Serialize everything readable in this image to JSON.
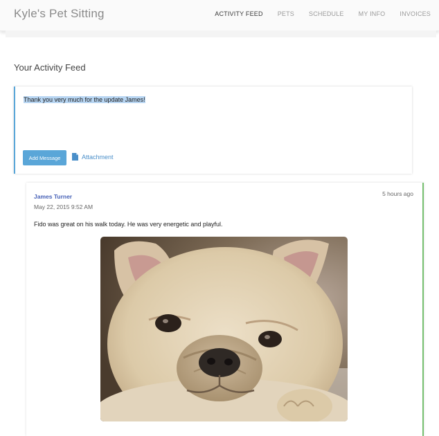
{
  "app": {
    "title": "Kyle's Pet Sitting"
  },
  "nav": {
    "items": [
      {
        "label": "ACTIVITY FEED"
      },
      {
        "label": "PETS"
      },
      {
        "label": "SCHEDULE"
      },
      {
        "label": "MY INFO"
      },
      {
        "label": "INVOICES"
      }
    ],
    "active": "ACTIVITY FEED"
  },
  "page": {
    "title": "Your Activity Feed"
  },
  "composer": {
    "message_value": "Thank you very much for the update James!",
    "add_button_label": "Add Message",
    "attachment_label": "Attachment",
    "accent_color": "#5aa6d8"
  },
  "feed": {
    "posts": [
      {
        "author": "James Turner",
        "date": "May 22, 2015 9:52 AM",
        "time_ago": "5 hours ago",
        "body": "Fido was great on his walk today. He was very energetic and playful.",
        "image": "french-bulldog-photo",
        "accent_color": "#76c06f"
      }
    ]
  }
}
